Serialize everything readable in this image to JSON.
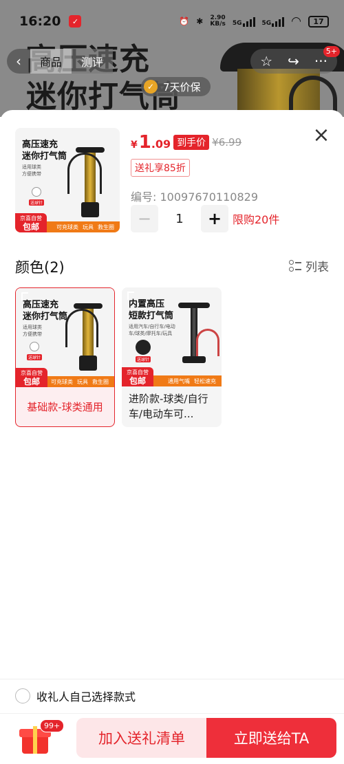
{
  "status_bar": {
    "time": "16:20",
    "speed_value": "2.90",
    "speed_unit": "KB/s",
    "net1": "5G",
    "net2": "5G",
    "battery": "17"
  },
  "background": {
    "hero_line1": "高压速充",
    "hero_line2": "迷你打气筒",
    "nav_tabs": [
      "商品",
      "测评"
    ],
    "cart_badge": "5+",
    "price_guarantee": "7天价保"
  },
  "product": {
    "currency": "¥",
    "price_int": "1",
    "price_dec": ".09",
    "price_tag": "到手价",
    "original_price": "¥6.99",
    "coupon": "送礼享85折",
    "sku_label": "编号: 10097670110829",
    "quantity": "1",
    "limit": "限购20件",
    "minus": "−",
    "plus": "+"
  },
  "thumb_main": {
    "title_line1": "高压速充",
    "title_line2": "迷你打气筒",
    "sub1": "适用球类",
    "sub2": "方便携带",
    "gift": "送球针",
    "badge_top": "京喜自营",
    "badge_bottom": "包邮",
    "strip": [
      "可充球类",
      "玩具",
      "救生圈"
    ]
  },
  "color_section": {
    "title": "颜色(2)",
    "list_label": "列表"
  },
  "options": [
    {
      "label": "基础款-球类通用",
      "title_line1": "高压速充",
      "title_line2": "迷你打气筒",
      "sub1": "适用球类",
      "sub2": "方便携带",
      "gift": "送球针",
      "badge_top": "京喜自营",
      "badge_bottom": "包邮",
      "strip": [
        "可充球类",
        "玩具",
        "救生圈"
      ]
    },
    {
      "label": "进阶款-球类/自行车/电动车可...",
      "title_line1": "内置高压",
      "title_line2": "短款打气筒",
      "sub1": "适用汽车/自行车/电动",
      "sub2": "车/球类/摩托车/玩具",
      "gift": "送球针",
      "badge_top": "京喜自营",
      "badge_bottom": "包邮",
      "strip": [
        "通用气嘴",
        "轻松速充"
      ]
    }
  ],
  "footer": {
    "recipient_text": "收礼人自己选择款式",
    "gift_badge": "99+",
    "add_list_btn": "加入送礼清单",
    "send_btn": "立即送给TA"
  },
  "colors": {
    "accent": "#e4242b",
    "send_button": "#ee2f3a",
    "list_button_bg": "#fde6e8",
    "strip_orange": "#f07a16"
  }
}
